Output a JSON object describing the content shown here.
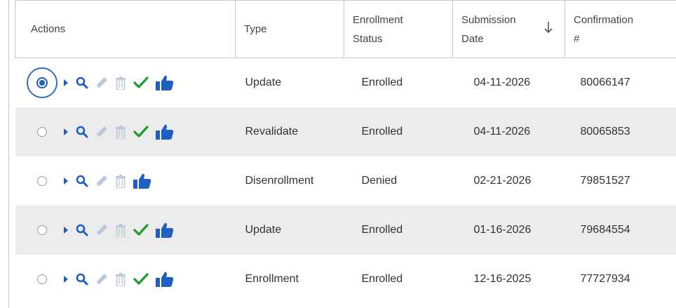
{
  "table": {
    "headers": {
      "actions": "Actions",
      "type": "Type",
      "status_line1": "Enrollment",
      "status_line2": "Status",
      "date_line1": "Submission",
      "date_line2": "Date",
      "conf_line1": "Confirmation",
      "conf_line2": "#"
    },
    "sort": {
      "column": "Submission Date",
      "direction": "descending"
    },
    "rows": [
      {
        "selected": true,
        "has_check": true,
        "type": "Update",
        "status": "Enrolled",
        "date": "04-11-2026",
        "confirmation": "80066147"
      },
      {
        "selected": false,
        "has_check": true,
        "type": "Revalidate",
        "status": "Enrolled",
        "date": "04-11-2026",
        "confirmation": "80065853"
      },
      {
        "selected": false,
        "has_check": false,
        "type": "Disenrollment",
        "status": "Denied",
        "date": "02-21-2026",
        "confirmation": "79851527"
      },
      {
        "selected": false,
        "has_check": true,
        "type": "Update",
        "status": "Enrolled",
        "date": "01-16-2026",
        "confirmation": "79684554"
      },
      {
        "selected": false,
        "has_check": true,
        "type": "Enrollment",
        "status": "Enrolled",
        "date": "12-16-2025",
        "confirmation": "77727934"
      }
    ]
  },
  "icons": {
    "expand": "caret-right-icon",
    "view": "search-icon",
    "edit": "pencil-icon",
    "delete": "trash-icon",
    "approved": "check-icon",
    "like": "thumbs-up-icon",
    "sort": "arrow-down-icon"
  },
  "colors": {
    "primary_blue": "#1f5fbf",
    "disabled_icon": "#b9c9da",
    "check_green": "#1e9a2a",
    "row_stripe": "#ececec",
    "border": "#c8c8c8"
  }
}
